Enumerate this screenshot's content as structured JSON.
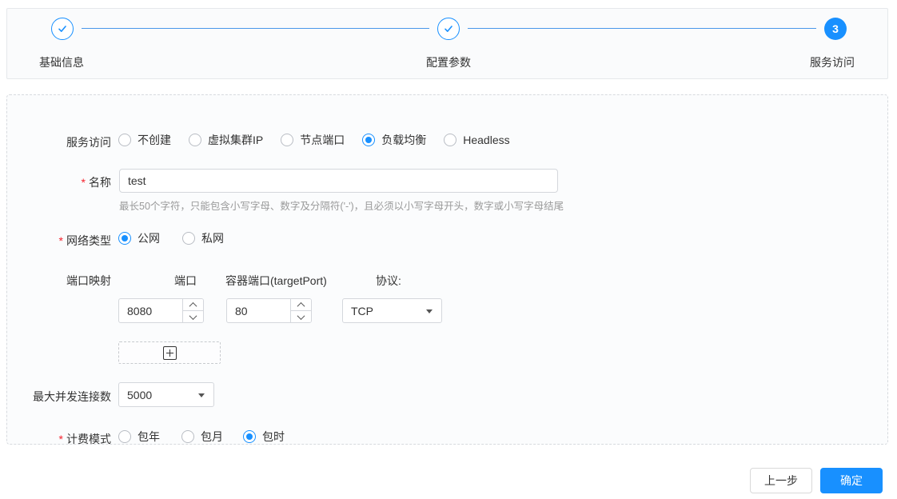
{
  "stepper": {
    "steps": [
      {
        "label": "基础信息",
        "state": "done"
      },
      {
        "label": "配置参数",
        "state": "done"
      },
      {
        "label": "服务访问",
        "state": "current",
        "number": "3"
      }
    ]
  },
  "form": {
    "service_access": {
      "label": "服务访问",
      "options": [
        "不创建",
        "虚拟集群IP",
        "节点端口",
        "负载均衡",
        "Headless"
      ],
      "selected": "负载均衡"
    },
    "name": {
      "label": "名称",
      "value": "test",
      "help": "最长50个字符，只能包含小写字母、数字及分隔符('-')，且必须以小写字母开头，数字或小写字母结尾"
    },
    "network_type": {
      "label": "网络类型",
      "options": [
        "公网",
        "私网"
      ],
      "selected": "公网"
    },
    "port_mapping": {
      "label": "端口映射",
      "port_header": "端口",
      "target_port_header": "容器端口(targetPort)",
      "protocol_header": "协议:",
      "port_value": "8080",
      "target_port_value": "80",
      "protocol_value": "TCP"
    },
    "max_connections": {
      "label": "最大并发连接数",
      "value": "5000"
    },
    "billing_mode": {
      "label": "计费模式",
      "options": [
        "包年",
        "包月",
        "包时"
      ],
      "selected": "包时"
    }
  },
  "footer": {
    "prev_label": "上一步",
    "confirm_label": "确定"
  },
  "colors": {
    "primary": "#1890ff",
    "required": "#f5222d"
  }
}
